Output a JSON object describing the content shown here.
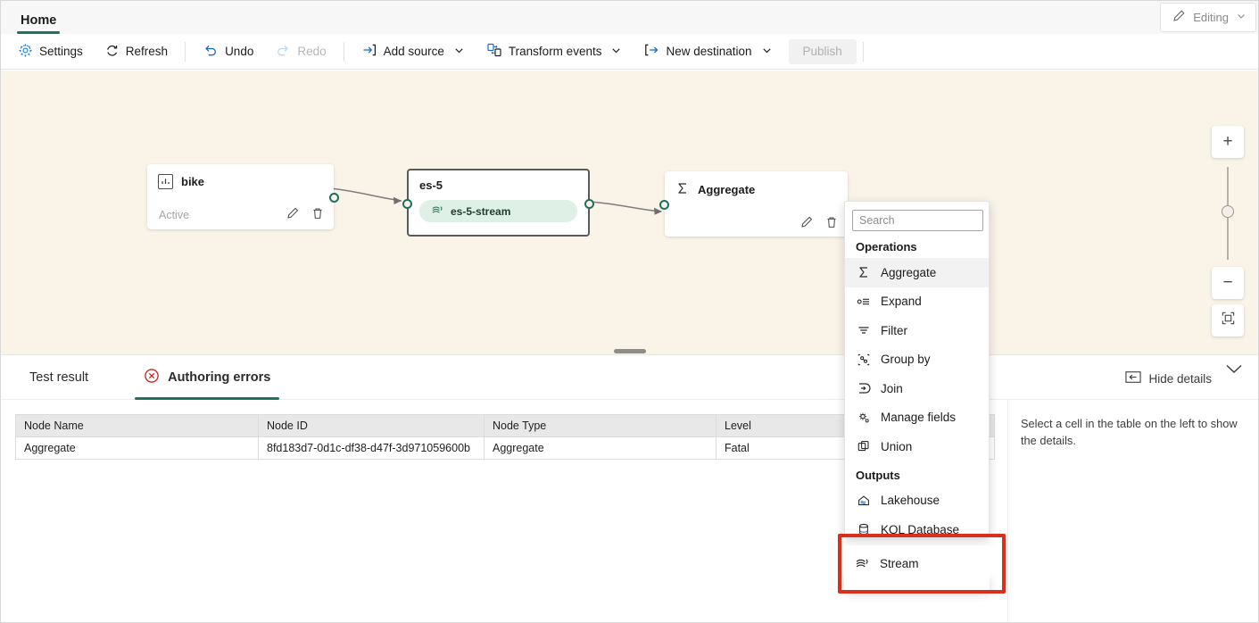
{
  "window": {
    "tab_label": "Home",
    "editing": {
      "label": "Editing",
      "icon": "pencil-icon"
    },
    "accent_green": "#1d7262",
    "canvas_bg": "#faf3e8",
    "highlight_red": "#d8301b"
  },
  "toolbar": {
    "items": [
      {
        "label": "Settings",
        "icon": "gear-icon",
        "disabled": false,
        "caret": false
      },
      {
        "label": "Refresh",
        "icon": "refresh-icon",
        "disabled": false,
        "caret": false
      },
      {
        "label": "Undo",
        "icon": "undo-icon",
        "disabled": false,
        "caret": false
      },
      {
        "label": "Redo",
        "icon": "redo-icon",
        "disabled": true,
        "caret": false
      },
      {
        "label": "Add source",
        "icon": "add-source-icon",
        "disabled": false,
        "caret": true
      },
      {
        "label": "Transform events",
        "icon": "transform-events-icon",
        "disabled": false,
        "caret": true
      },
      {
        "label": "New destination",
        "icon": "new-destination-icon",
        "disabled": false,
        "caret": true
      }
    ],
    "publish_label": "Publish"
  },
  "canvas": {
    "nodes": [
      {
        "id": "bike",
        "title": "bike",
        "icon": "chart-bars-icon",
        "status": "Active",
        "actions": [
          "edit-icon",
          "delete-icon"
        ]
      },
      {
        "id": "es-5",
        "title": "es-5",
        "pill_label": "es-5-stream",
        "pill_icon": "stream-icon"
      },
      {
        "id": "aggregate",
        "title": "Aggregate",
        "icon": "sigma-icon",
        "actions": [
          "edit-icon",
          "delete-icon"
        ]
      }
    ],
    "zoom_controls": {
      "zoom_in": "+",
      "zoom_out": "−",
      "fit_to_view": "fit-to-view-icon"
    }
  },
  "flyout": {
    "search_placeholder": "Search",
    "search_value": "",
    "groups": [
      {
        "heading": "Operations",
        "items": [
          {
            "label": "Aggregate",
            "icon": "sigma-icon",
            "highlighted": true
          },
          {
            "label": "Expand",
            "icon": "expand-icon",
            "highlighted": false
          },
          {
            "label": "Filter",
            "icon": "filter-icon",
            "highlighted": false
          },
          {
            "label": "Group by",
            "icon": "group-by-icon",
            "highlighted": false
          },
          {
            "label": "Join",
            "icon": "join-icon",
            "highlighted": false
          },
          {
            "label": "Manage fields",
            "icon": "manage-fields-icon",
            "highlighted": false
          },
          {
            "label": "Union",
            "icon": "union-icon",
            "highlighted": false
          }
        ]
      },
      {
        "heading": "Outputs",
        "items": [
          {
            "label": "Lakehouse",
            "icon": "lakehouse-icon",
            "highlighted": false
          },
          {
            "label": "KQL Database",
            "icon": "kql-database-icon",
            "highlighted": false
          },
          {
            "label": "Stream",
            "icon": "stream-icon",
            "highlighted": false
          }
        ]
      }
    ],
    "highlighted_output": "Stream"
  },
  "bottom_panel": {
    "tabs": [
      {
        "label": "Test result",
        "icon": "",
        "active": false
      },
      {
        "label": "Authoring errors",
        "icon": "error-circle-icon",
        "active": true
      }
    ],
    "hide_details_label": "Hide details",
    "hide_details_icon": "panel-right-icon",
    "collapse_icon": "chevron-down-icon",
    "table": {
      "columns": [
        "Node Name",
        "Node ID",
        "Node Type",
        "Level"
      ],
      "rows": [
        [
          "Aggregate",
          "8fd183d7-0d1c-df38-d47f-3d971059600b",
          "Aggregate",
          "Fatal"
        ]
      ]
    },
    "detail_placeholder": "Select a cell in the table on the left to show the details."
  }
}
